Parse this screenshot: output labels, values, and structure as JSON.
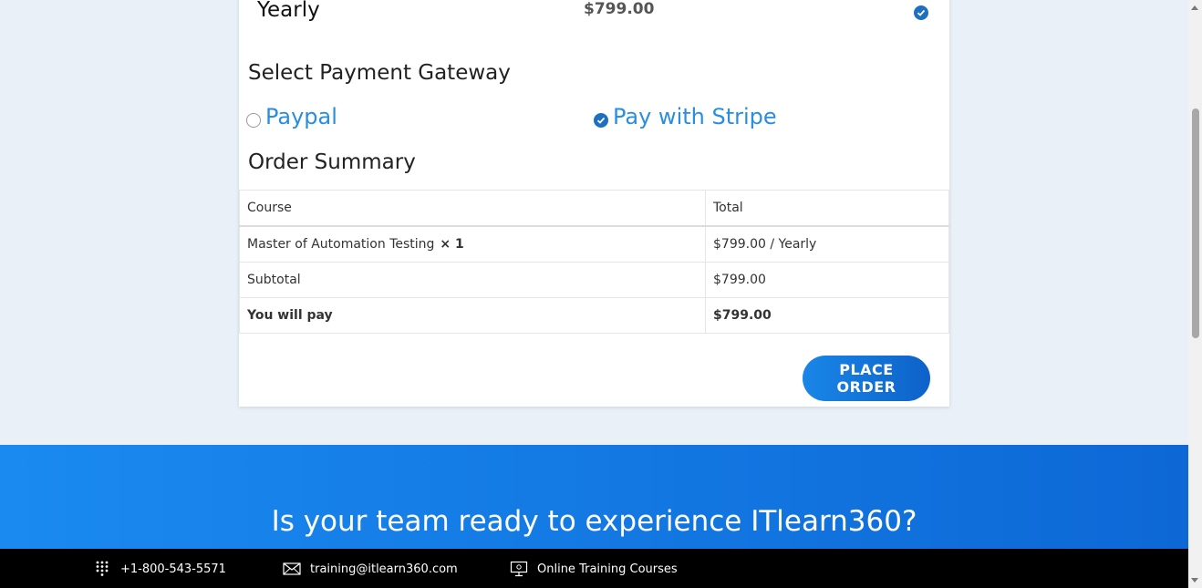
{
  "plan": {
    "name": "Yearly",
    "price": "$799.00"
  },
  "gateway": {
    "title": "Select Payment Gateway",
    "options": [
      {
        "label": "Paypal",
        "selected": false
      },
      {
        "label": "Pay with Stripe",
        "selected": true
      }
    ]
  },
  "order_summary": {
    "title": "Order Summary",
    "headers": [
      "Course",
      "Total"
    ],
    "rows": [
      {
        "course": "Master of Automation Testing",
        "qty": "× 1",
        "total": "$799.00 / Yearly"
      },
      {
        "course": "Subtotal",
        "total": "$799.00"
      },
      {
        "course": "You will pay",
        "total": "$799.00"
      }
    ]
  },
  "place_order_label": "PLACE ORDER",
  "cta": {
    "title": "Is your team ready to experience ITlearn360?"
  },
  "footer": {
    "phone": "+1-800-543-5571",
    "email": "training@itlearn360.com",
    "courses": "Online Training Courses"
  },
  "colors": {
    "accent": "#1e6fc2",
    "link": "#2a8ee0",
    "cta_bg": "#1a8af0",
    "footer_bg": "#000000"
  }
}
